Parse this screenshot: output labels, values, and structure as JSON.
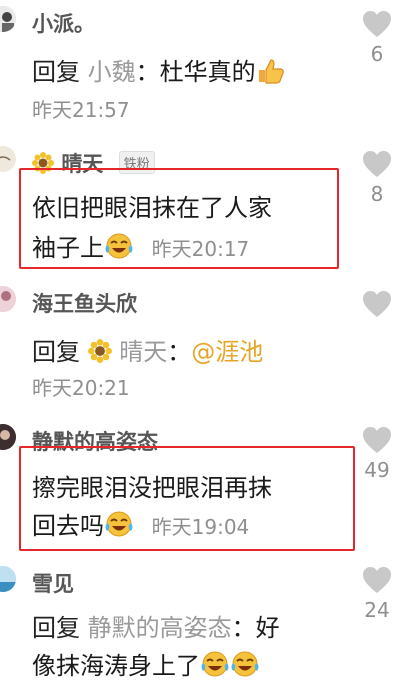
{
  "comments": [
    {
      "username": "小派。",
      "reply_word": "回复",
      "reply_to": "小魏",
      "colon": "：",
      "text": "杜华真的",
      "time": "昨天21:57",
      "likes": "6"
    },
    {
      "username": "晴天",
      "badge": "铁粉",
      "text_line1": "依旧把眼泪抹在了人家",
      "text_line2": "袖子上",
      "time": "昨天20:17",
      "likes": "8"
    },
    {
      "username": "海王鱼头欣",
      "reply_word": "回复",
      "reply_to": "晴天",
      "colon": "：",
      "at_text": "@涯池",
      "time": "昨天20:21"
    },
    {
      "username": "静默的高姿态",
      "text_line1": "擦完眼泪没把眼泪再抹",
      "text_line2": "回去吗",
      "time": "昨天19:04",
      "likes": "49"
    },
    {
      "username": "雪见",
      "reply_word": "回复",
      "reply_to": "静默的高姿态",
      "colon": "：",
      "text_line1": "好",
      "text_line2": "像抹海涛身上了",
      "likes": "24"
    }
  ],
  "icons": {
    "like": "heart-icon",
    "thumbs_up": "thumbs-up-emoji",
    "laugh_cry": "laughing-crying-emoji",
    "sunflower": "sunflower-emoji"
  },
  "colors": {
    "highlight_border": "#e5262b",
    "mention": "#e8a427",
    "heart": "#c8c8c8"
  }
}
